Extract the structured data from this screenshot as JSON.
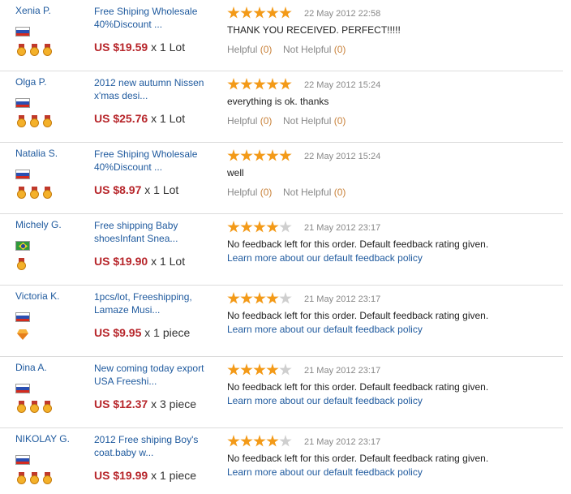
{
  "colors": {
    "link": "#1f5a9e",
    "price": "#b7262b",
    "star_on": "#f39a18",
    "star_off": "#cfcfcf",
    "helpful_count": "#c9823a",
    "divider": "#dcdcdc"
  },
  "feedback": [
    {
      "buyer": "Xenia P.",
      "flag": "flag-russia",
      "badge": "medal-icon",
      "badge_count": 3,
      "product": "Free Shiping Wholesale 40%Discount ...",
      "price": "US $19.59",
      "quantity": "x 1 Lot",
      "rating": 5,
      "date": "22 May 2012 22:58",
      "comment": "THANK YOU RECEIVED. PERFECT!!!!!",
      "helpful_label": "Helpful",
      "helpful_count": "(0)",
      "not_helpful_label": "Not Helpful",
      "not_helpful_count": "(0)"
    },
    {
      "buyer": "Olga P.",
      "flag": "flag-russia",
      "badge": "medal-icon",
      "badge_count": 3,
      "product": "2012 new autumn Nissen x'mas desi...",
      "price": "US $25.76",
      "quantity": "x 1 Lot",
      "rating": 5,
      "date": "22 May 2012 15:24",
      "comment": "everything is ok. thanks",
      "helpful_label": "Helpful",
      "helpful_count": "(0)",
      "not_helpful_label": "Not Helpful",
      "not_helpful_count": "(0)"
    },
    {
      "buyer": "Natalia S.",
      "flag": "flag-russia",
      "badge": "medal-icon",
      "badge_count": 3,
      "product": "Free Shiping Wholesale 40%Discount ...",
      "price": "US $8.97",
      "quantity": "x 1 Lot",
      "rating": 5,
      "date": "22 May 2012 15:24",
      "comment": "well",
      "helpful_label": "Helpful",
      "helpful_count": "(0)",
      "not_helpful_label": "Not Helpful",
      "not_helpful_count": "(0)"
    },
    {
      "buyer": "Michely G.",
      "flag": "flag-brazil",
      "badge": "medal-icon",
      "badge_count": 1,
      "product": "Free shipping Baby shoesInfant Snea...",
      "price": "US $19.90",
      "quantity": "x 1 Lot",
      "rating": 4,
      "date": "21 May 2012 23:17",
      "comment": "No feedback left for this order. Default feedback rating given.",
      "policy_link": "Learn more about our default feedback policy"
    },
    {
      "buyer": "Victoria K.",
      "flag": "flag-russia",
      "badge": "diamond-icon",
      "badge_count": 1,
      "product": "1pcs/lot, Freeshipping, Lamaze Musi...",
      "price": "US $9.95",
      "quantity": "x 1 piece",
      "rating": 4,
      "date": "21 May 2012 23:17",
      "comment": "No feedback left for this order. Default feedback rating given.",
      "policy_link": "Learn more about our default feedback policy"
    },
    {
      "buyer": "Dina A.",
      "flag": "flag-russia",
      "badge": "medal-icon",
      "badge_count": 3,
      "product": "New coming today export USA Freeshi...",
      "price": "US $12.37",
      "quantity": "x 3 piece",
      "rating": 4,
      "date": "21 May 2012 23:17",
      "comment": "No feedback left for this order. Default feedback rating given.",
      "policy_link": "Learn more about our default feedback policy"
    },
    {
      "buyer": "NIKOLAY G.",
      "flag": "flag-russia",
      "badge": "medal-icon",
      "badge_count": 3,
      "product": "2012 Free shiping Boy's coat.baby w...",
      "price": "US $19.99",
      "quantity": "x 1 piece",
      "rating": 4,
      "date": "21 May 2012 23:17",
      "comment": "No feedback left for this order. Default feedback rating given.",
      "policy_link": "Learn more about our default feedback policy"
    }
  ]
}
